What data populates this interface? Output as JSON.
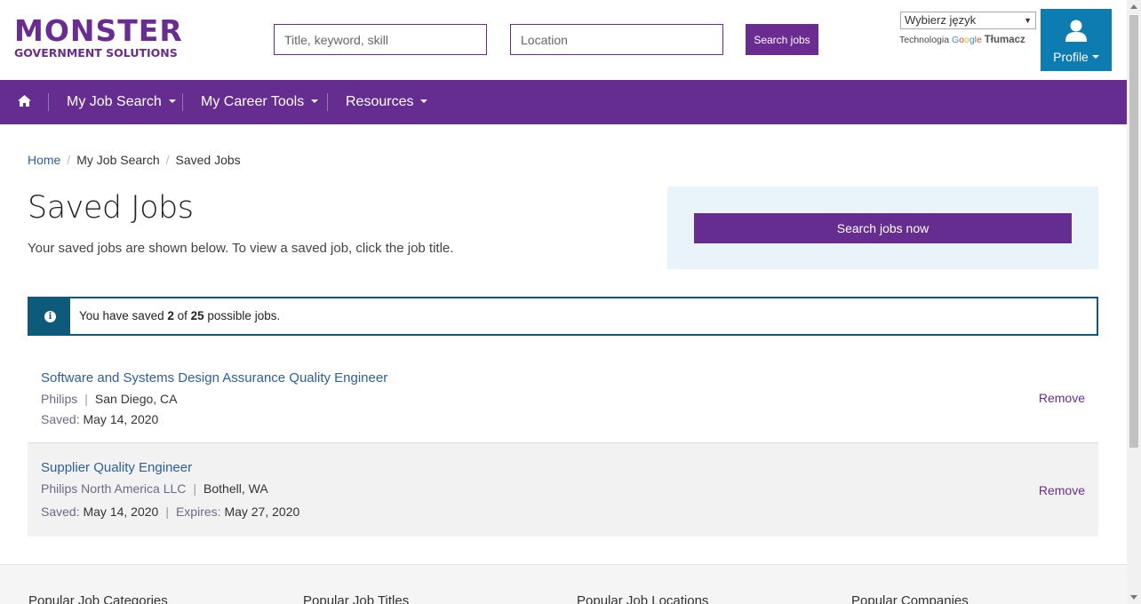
{
  "brand": {
    "logo_top": "MONSTER",
    "logo_bottom": "GOVERNMENT SOLUTIONS",
    "color": "#6a2c91"
  },
  "header": {
    "keyword_placeholder": "Title, keyword, skill",
    "location_placeholder": "Location",
    "search_button": "Search jobs",
    "language_select": "Wybierz język",
    "powered_prefix": "Technologia",
    "powered_google": [
      "G",
      "o",
      "o",
      "g",
      "l",
      "e"
    ],
    "powered_suffix": "Tłumacz",
    "profile_label": "Profile",
    "profile_icon": "user-icon"
  },
  "nav": {
    "home_icon": "home-icon",
    "items": [
      {
        "label": "My Job Search"
      },
      {
        "label": "My Career Tools"
      },
      {
        "label": "Resources"
      }
    ]
  },
  "breadcrumb": [
    "Home",
    "My Job Search",
    "Saved Jobs"
  ],
  "page": {
    "title": "Saved Jobs",
    "intro": "Your saved jobs are shown below. To view a saved job, click the job title.",
    "side_button": "Search jobs now"
  },
  "alert": {
    "icon": "info-icon",
    "prefix": "You have saved ",
    "saved": "2",
    "middle": " of ",
    "max": "25",
    "suffix": " possible jobs."
  },
  "jobs": [
    {
      "title": "Software and Systems Design Assurance Quality Engineer",
      "company": "Philips",
      "location": "San Diego, CA",
      "saved_label": "Saved:",
      "saved_date": "May 14, 2020",
      "remove": "Remove"
    },
    {
      "title": "Supplier Quality Engineer",
      "company": "Philips North America LLC",
      "location": "Bothell, WA",
      "saved_label": "Saved:",
      "saved_date": "May 14, 2020",
      "expires_label": "Expires:",
      "expires_date": "May 27, 2020",
      "remove": "Remove"
    }
  ],
  "footer": {
    "columns": [
      "Popular Job Categories",
      "Popular Job Titles",
      "Popular Job Locations",
      "Popular Companies"
    ]
  },
  "colors": {
    "nav_bg": "#662d91",
    "profile_bg": "#0d7cb0",
    "alert_border": "#0e5a7a",
    "side_box_bg": "#e8f4fa",
    "link": "#2b5f9e"
  }
}
